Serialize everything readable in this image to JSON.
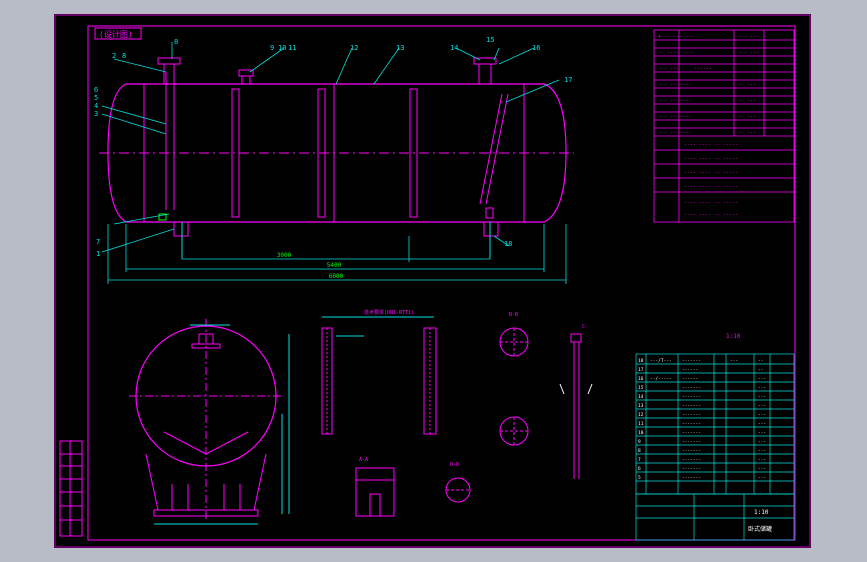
{
  "drawing": {
    "title_box": "(设计图)",
    "item_numbers": [
      "2",
      "8",
      "6",
      "5",
      "4",
      "3",
      "7",
      "1",
      "9",
      "10",
      "11",
      "12",
      "13",
      "14",
      "15",
      "16",
      "17",
      "18"
    ],
    "dim_total": "5400",
    "dim_overall": "6000",
    "dim_support": "3000",
    "tech_note": "技术要求(DN1-NTT1)",
    "section_a_label": "A-A",
    "section_b_label": "B-B",
    "section_c_label": "C",
    "section_d_label": "D-D",
    "scale_label": "1:10",
    "title_block_name": "卧式储罐",
    "title_block_scale": "1:10"
  },
  "colors": {
    "background": "#000000",
    "frame": "#c800c8",
    "magenta": "#ff00ff",
    "cyan": "#00e0e0",
    "green": "#00ff00",
    "white": "#ffffff",
    "yellow": "#ffff00"
  }
}
